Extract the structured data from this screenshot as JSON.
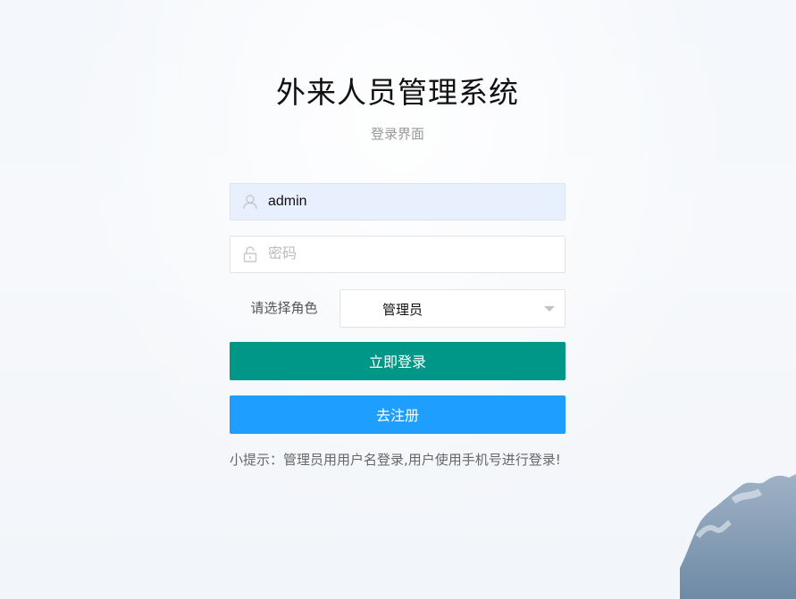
{
  "header": {
    "title": "外来人员管理系统",
    "subtitle": "登录界面"
  },
  "form": {
    "username": {
      "value": "admin",
      "icon": "user-icon"
    },
    "password": {
      "placeholder": "密码",
      "icon": "lock-icon"
    },
    "role": {
      "label": "请选择角色",
      "selected": "管理员"
    },
    "login_button": "立即登录",
    "register_button": "去注册",
    "tip": "小提示：管理员用用户名登录,用户使用手机号进行登录!"
  },
  "colors": {
    "login_button": "#009688",
    "register_button": "#1e9fff"
  }
}
